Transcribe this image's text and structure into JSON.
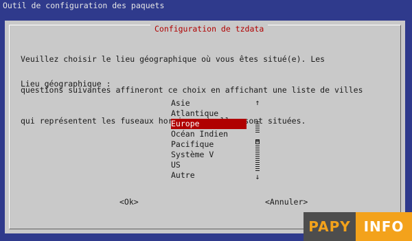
{
  "window": {
    "title": "Outil de configuration des paquets"
  },
  "dialog": {
    "title": "Configuration de tzdata",
    "message_lines": [
      "Veuillez choisir le lieu géographique où vous êtes situé(e). Les",
      "questions suivantes affineront ce choix en affichant une liste de villes",
      "qui représentent les fuseaux horaires où elles sont situées."
    ],
    "label": "Lieu géographique :",
    "options": [
      "Asie",
      "Atlantique",
      "Europe",
      "Océan Indien",
      "Pacifique",
      "Système V",
      "US",
      "Autre"
    ],
    "selected": "Europe",
    "scroll": {
      "up_arrow": "↑",
      "down_arrow": "↓"
    },
    "buttons": {
      "ok": "<Ok>",
      "cancel": "<Annuler>"
    }
  },
  "watermark": {
    "left": "PAPY",
    "right": "INFO"
  },
  "colors": {
    "background": "#2f3a8c",
    "dialog": "#c9c9c9",
    "accent": "#b00000",
    "watermark_orange": "#f3a21b",
    "watermark_gray": "#4d4d4d"
  }
}
